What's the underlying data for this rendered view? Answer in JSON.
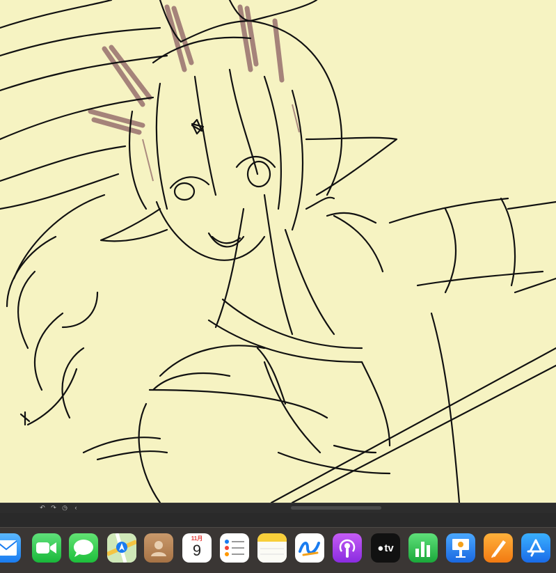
{
  "canvas": {
    "background_color": "#f6f3c2",
    "line_color": "#111111",
    "sketch_color": "#8a5e62"
  },
  "toolbar": {
    "icons": [
      "undo-icon",
      "redo-icon",
      "timer-icon",
      "chevron-left-icon"
    ]
  },
  "dock": {
    "apps": [
      {
        "name": "Mail",
        "icon": "mail-icon"
      },
      {
        "name": "FaceTime",
        "icon": "facetime-icon"
      },
      {
        "name": "Messages",
        "icon": "messages-icon"
      },
      {
        "name": "Maps",
        "icon": "maps-icon"
      },
      {
        "name": "Contacts",
        "icon": "contacts-icon"
      },
      {
        "name": "Calendar",
        "icon": "calendar-icon",
        "month": "11月",
        "day": "9"
      },
      {
        "name": "Reminders",
        "icon": "reminders-icon"
      },
      {
        "name": "Notes",
        "icon": "notes-icon"
      },
      {
        "name": "Freeform",
        "icon": "freeform-icon"
      },
      {
        "name": "Podcasts",
        "icon": "podcasts-icon"
      },
      {
        "name": "TV",
        "icon": "tv-icon",
        "label": "tv"
      },
      {
        "name": "Numbers",
        "icon": "numbers-icon"
      },
      {
        "name": "Keynote",
        "icon": "keynote-icon"
      },
      {
        "name": "Pages",
        "icon": "pages-icon"
      },
      {
        "name": "App Store",
        "icon": "app-store-icon"
      }
    ]
  }
}
